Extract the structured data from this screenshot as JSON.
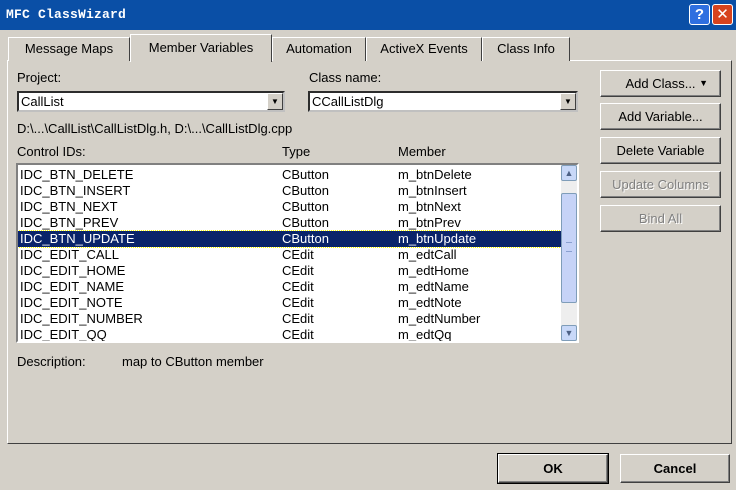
{
  "window": {
    "title": "MFC ClassWizard",
    "help_glyph": "?",
    "close_glyph": "✕"
  },
  "tabs": [
    {
      "label": "Message Maps"
    },
    {
      "label": "Member Variables"
    },
    {
      "label": "Automation"
    },
    {
      "label": "ActiveX Events"
    },
    {
      "label": "Class Info"
    }
  ],
  "project": {
    "label": "Project:",
    "value": "CallList"
  },
  "class_name": {
    "label": "Class name:",
    "value": "CCallListDlg"
  },
  "file_path": "D:\\...\\CallList\\CallListDlg.h, D:\\...\\CallListDlg.cpp",
  "list": {
    "headers": {
      "id": "Control IDs:",
      "type": "Type",
      "member": "Member"
    },
    "rows": [
      {
        "id": "IDC_BTN_DELETE",
        "type": "CButton",
        "member": "m_btnDelete"
      },
      {
        "id": "IDC_BTN_INSERT",
        "type": "CButton",
        "member": "m_btnInsert"
      },
      {
        "id": "IDC_BTN_NEXT",
        "type": "CButton",
        "member": "m_btnNext"
      },
      {
        "id": "IDC_BTN_PREV",
        "type": "CButton",
        "member": "m_btnPrev"
      },
      {
        "id": "IDC_BTN_UPDATE",
        "type": "CButton",
        "member": "m_btnUpdate"
      },
      {
        "id": "IDC_EDIT_CALL",
        "type": "CEdit",
        "member": "m_edtCall"
      },
      {
        "id": "IDC_EDIT_HOME",
        "type": "CEdit",
        "member": "m_edtHome"
      },
      {
        "id": "IDC_EDIT_NAME",
        "type": "CEdit",
        "member": "m_edtName"
      },
      {
        "id": "IDC_EDIT_NOTE",
        "type": "CEdit",
        "member": "m_edtNote"
      },
      {
        "id": "IDC_EDIT_NUMBER",
        "type": "CEdit",
        "member": "m_edtNumber"
      },
      {
        "id": "IDC_EDIT_QQ",
        "type": "CEdit",
        "member": "m_edtQq"
      }
    ]
  },
  "description": {
    "label": "Description:",
    "value": "map to CButton member"
  },
  "buttons": {
    "add_class": "Add Class...",
    "add_variable": "Add Variable...",
    "delete_variable": "Delete Variable",
    "update_columns": "Update Columns",
    "bind_all": "Bind All",
    "ok": "OK",
    "cancel": "Cancel"
  },
  "icons": {
    "combo_arrow": "▼",
    "scroll_up": "▲",
    "scroll_down": "▼",
    "add_class_dropdown": "▼"
  }
}
